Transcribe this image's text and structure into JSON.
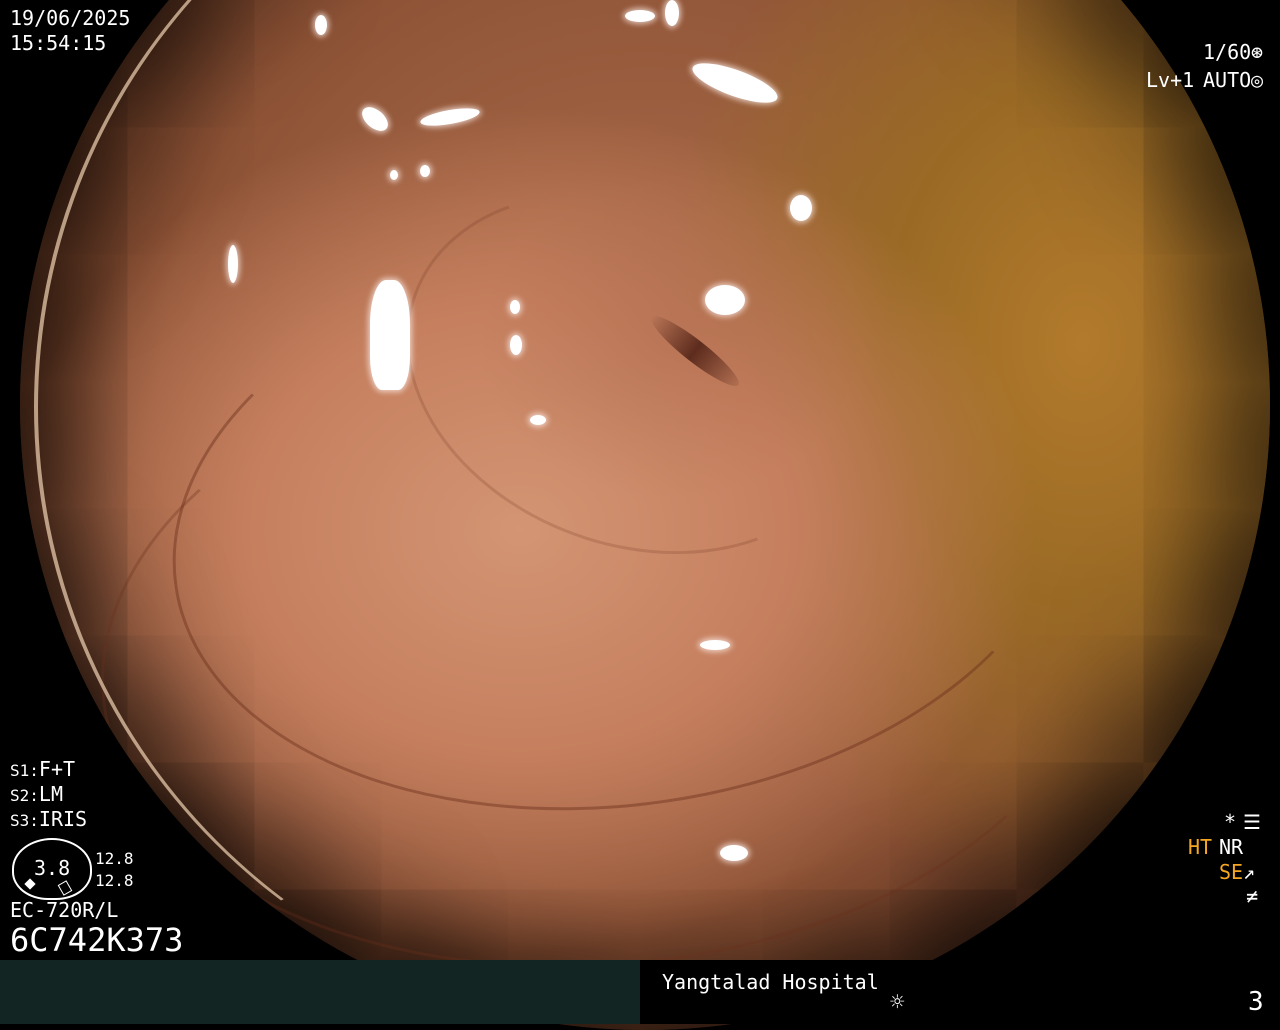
{
  "header": {
    "date": "19/06/2025",
    "time": "15:54:15"
  },
  "settings": {
    "shutter": "1/60",
    "level": "Lv+1",
    "iris_mode": "AUTO"
  },
  "scope_modes": {
    "s1_label": "S1:",
    "s1_value": "F+T",
    "s2_label": "S2:",
    "s2_value": "LM",
    "s3_label": "S3:",
    "s3_value": "IRIS"
  },
  "gauge": {
    "center_value": "3.8",
    "top_value": "12.8",
    "bottom_value": "12.8"
  },
  "scope": {
    "model": "EC-720R/L",
    "serial": "6C742K373"
  },
  "enhancement": {
    "star": "*",
    "ht": "HT",
    "nr": "NR",
    "se": "SE"
  },
  "footer": {
    "hospital": "Yangtalad Hospital",
    "image_number": "3"
  },
  "colors": {
    "footer_left_bg": "#122523",
    "orange_indicator": "#f5a623"
  },
  "icons": [
    "shutter-icon",
    "iris-icon",
    "settings-icon",
    "structure-enhance-icon",
    "not-equal-icon",
    "brightness-icon"
  ]
}
